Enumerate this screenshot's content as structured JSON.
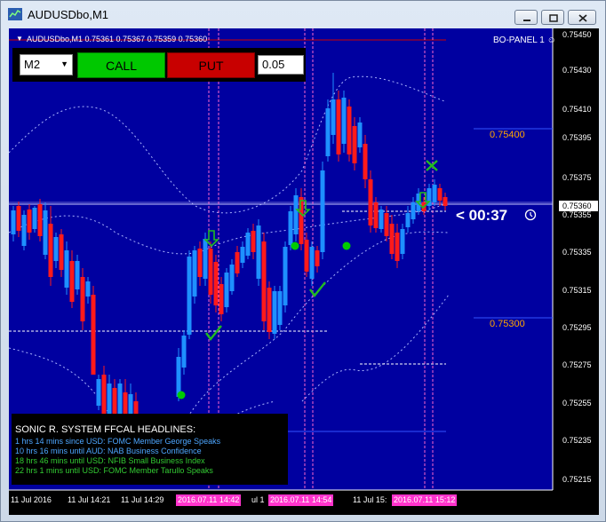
{
  "window": {
    "title": "AUDUSDbo,M1"
  },
  "chart": {
    "symbol_line": "AUDUSDbo,M1  0.75361 0.75367 0.75359 0.75360",
    "bo_panel_label": "BO-PANEL 1",
    "current_price": "0.75360",
    "timer": "< 00:37",
    "levels": [
      "0.75400",
      "0.75300"
    ],
    "y_axis": [
      "0.75450",
      "0.75430",
      "0.75410",
      "0.75395",
      "0.75375",
      "0.75355",
      "0.75335",
      "0.75315",
      "0.75295",
      "0.75275",
      "0.75255",
      "0.75235",
      "0.75215"
    ],
    "x_axis": [
      "11 Jul 2016",
      "11 Jul 14:21",
      "11 Jul 14:29",
      "ul 1",
      "11 Jul 15:"
    ],
    "x_tags": [
      "2016.07.11 14:42",
      "2016.07.11 14:54",
      "2016.07.11 15:12"
    ],
    "colors": {
      "background": "#0000a0",
      "bull": "#1e90ff",
      "bear": "#ff1a1a",
      "band": "#aab4ff",
      "vline": "#ff66cc",
      "signal": "#22bb22"
    }
  },
  "panel": {
    "timeframe": "M2",
    "call_label": "CALL",
    "put_label": "PUT",
    "amount": "0.05"
  },
  "news": {
    "title": "SONIC R. SYSTEM  FFCAL HEADLINES:",
    "items": [
      {
        "text": "1 hrs 14 mins since USD: FOMC Member George Speaks",
        "color": "#4da6ff"
      },
      {
        "text": "10 hrs 16 mins until AUD: NAB Business Confidence",
        "color": "#4da6ff"
      },
      {
        "text": "18 hrs 46 mins until USD: NFIB Small Business Index",
        "color": "#33cc33"
      },
      {
        "text": "22 hrs 1 mins until USD: FOMC Member Tarullo Speaks",
        "color": "#33cc33"
      }
    ]
  }
}
